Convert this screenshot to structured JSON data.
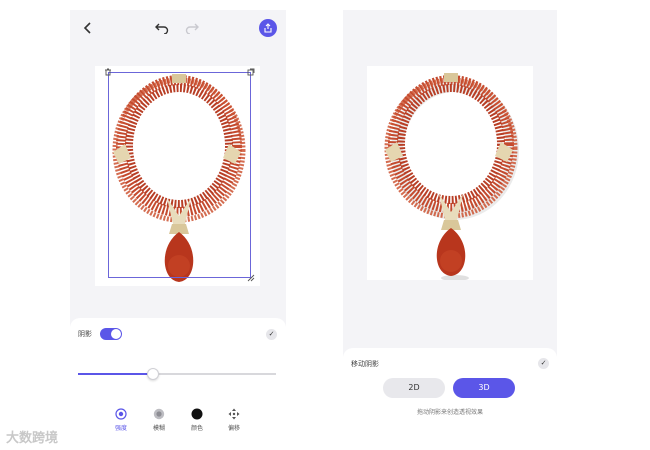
{
  "editor": {
    "shadow_label": "阴影",
    "tools": [
      {
        "label": "强度",
        "icon": "intensity-icon",
        "active": true
      },
      {
        "label": "模糊",
        "icon": "blur-icon",
        "active": false
      },
      {
        "label": "颜色",
        "icon": "color-icon",
        "active": false
      },
      {
        "label": "偏移",
        "icon": "offset-icon",
        "active": false
      }
    ],
    "shadow_enabled": true,
    "slider_value": 0.38,
    "accent_color": "#5b56e8"
  },
  "shadow_panel": {
    "title": "移动阴影",
    "option_2d": "2D",
    "option_3d": "3D",
    "selected": "3D",
    "hint": "拖动阴影来创造透视效果"
  },
  "watermark": "大数跨境"
}
